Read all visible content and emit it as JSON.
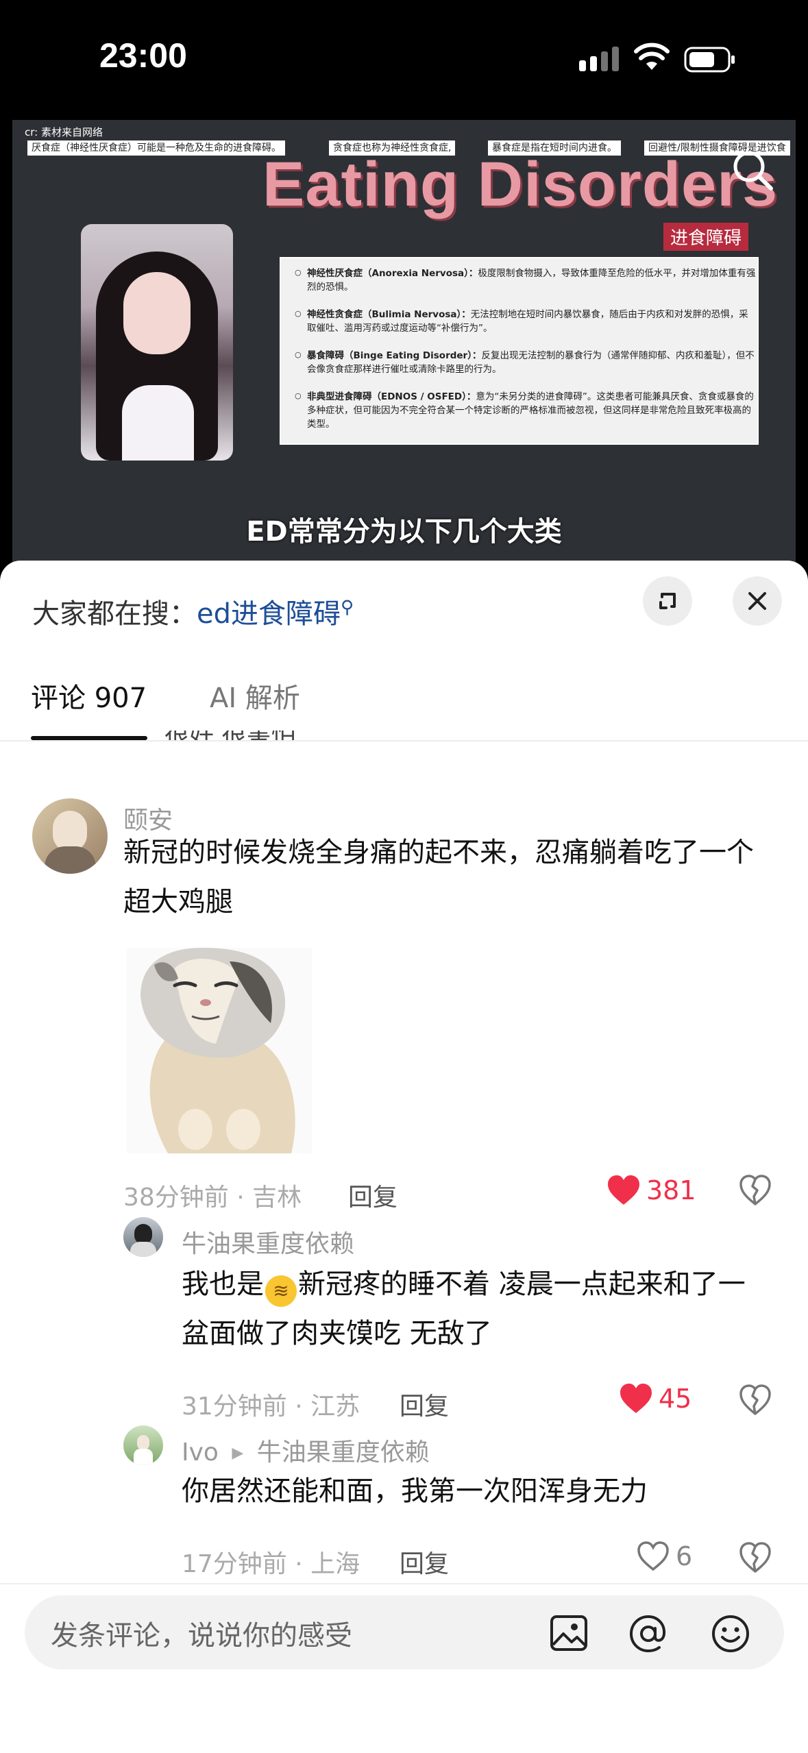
{
  "status_bar": {
    "time": "23:00"
  },
  "video": {
    "watermark": "cr: 素材来自网络",
    "tags": [
      "厌食症（神经性厌食症）可能是一种危及生命的进食障碍。",
      "贪食症也称为神经性贪食症,",
      "暴食症是指在短时间内进食。",
      "回避性/限制性摄食障碍是进饮食"
    ],
    "title": "Eating Disorders",
    "title_cn": "进食障碍",
    "bullets": [
      {
        "term": "神经性厌食症（Anorexia Nervosa）：",
        "text": "极度限制食物摄入，导致体重降至危险的低水平，并对增加体重有强烈的恐惧。"
      },
      {
        "term": "神经性贪食症（Bulimia Nervosa）：",
        "text": "无法控制地在短时间内暴饮暴食，随后由于内疚和对发胖的恐惧，采取催吐、滥用泻药或过度运动等“补偿行为”。"
      },
      {
        "term": "暴食障碍（Binge Eating Disorder）：",
        "text": "反复出现无法控制的暴食行为（通常伴随抑郁、内疚和羞耻），但不会像贪食症那样进行催吐或清除卡路里的行为。"
      },
      {
        "term": "非典型进食障碍（EDNOS / OSFED）：",
        "text": "意为“未另分类的进食障碍”。这类患者可能兼具厌食、贪食或暴食的多种症状，但可能因为不完全符合某一个特定诊断的严格标准而被忽视，但这同样是非常危险且致死率极高的类型。"
      }
    ],
    "subtitle": "ED常常分为以下几个大类"
  },
  "sheet": {
    "hot_search_prefix": "大家都在搜：",
    "hot_search_keyword": "ed进食障碍",
    "tabs": [
      {
        "label": "评论 907",
        "active": true
      },
      {
        "label": "AI 解析",
        "active": false
      }
    ],
    "peek_text": "很好 很害怕"
  },
  "comments": [
    {
      "user": "颐安",
      "text": "新冠的时候发烧全身痛的起不来，忍痛躺着吃了一个超大鸡腿",
      "time_loc": "38分钟前 · 吉林",
      "reply_label": "回复",
      "likes": "381",
      "liked": true,
      "has_sticker": true
    },
    {
      "user": "牛油果重度依赖",
      "text_before_emoji": "我也是",
      "text_after_emoji": "新冠疼的睡不着 凌晨一点起来和了一盆面做了肉夹馍吃 无敌了",
      "time_loc": "31分钟前 · 江苏",
      "reply_label": "回复",
      "likes": "45",
      "liked": true
    },
    {
      "user": "Ivo",
      "reply_to": "牛油果重度依赖",
      "text": "你居然还能和面，我第一次阳浑身无力",
      "time_loc": "17分钟前 · 上海",
      "reply_label": "回复",
      "likes": "6",
      "liked": false
    }
  ],
  "composer": {
    "placeholder": "发条评论，说说你的感受"
  },
  "colors": {
    "like_red": "#f0304a",
    "link_blue": "#1d4e97",
    "video_bg": "#2d3035",
    "title_pink": "#e79aa3"
  }
}
